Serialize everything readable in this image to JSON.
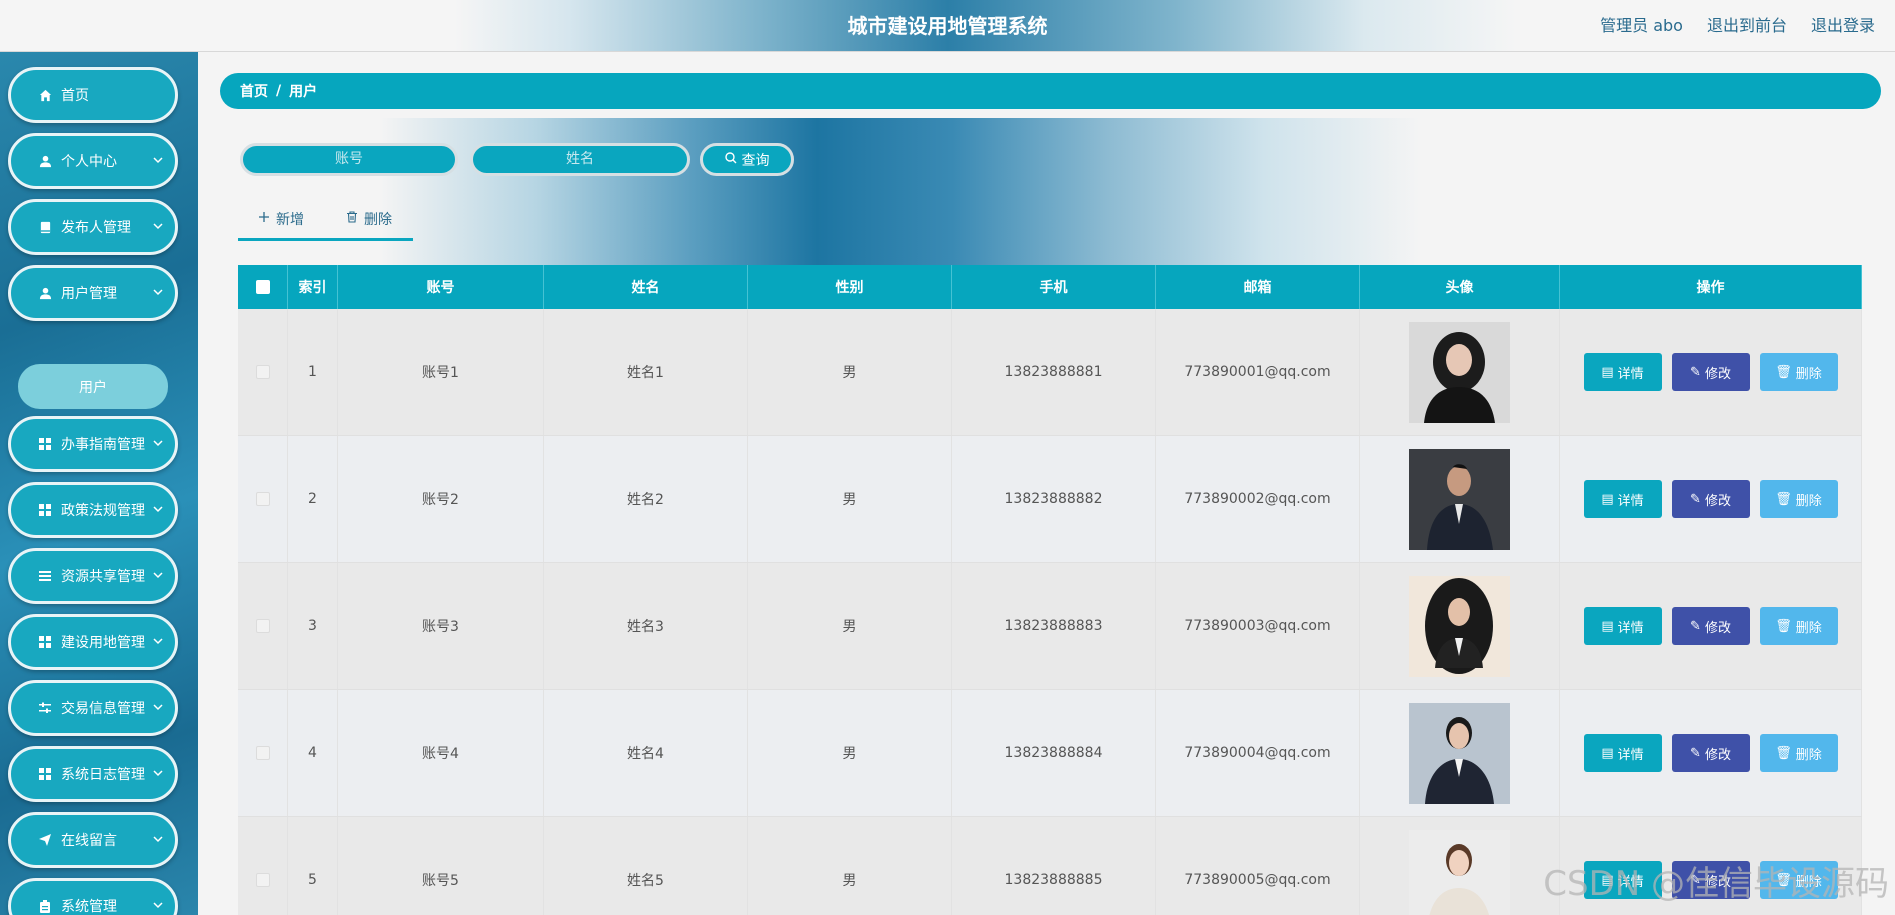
{
  "header": {
    "title": "城市建设用地管理系统",
    "admin_label": "管理员 abo",
    "front_link": "退出到前台",
    "logout_link": "退出登录"
  },
  "sidebar": {
    "items": [
      {
        "label": "首页",
        "icon": "home-icon"
      },
      {
        "label": "个人中心",
        "icon": "user-icon"
      },
      {
        "label": "发布人管理",
        "icon": "book-icon"
      },
      {
        "label": "用户管理",
        "icon": "user-icon"
      },
      {
        "label": "办事指南管理",
        "icon": "grid-icon"
      },
      {
        "label": "政策法规管理",
        "icon": "grid-icon"
      },
      {
        "label": "资源共享管理",
        "icon": "list-icon"
      },
      {
        "label": "建设用地管理",
        "icon": "grid-icon"
      },
      {
        "label": "交易信息管理",
        "icon": "sliders-icon"
      },
      {
        "label": "系统日志管理",
        "icon": "grid-icon"
      },
      {
        "label": "在线留言",
        "icon": "send-icon"
      },
      {
        "label": "系统管理",
        "icon": "clipboard-icon"
      }
    ],
    "subitem": "用户"
  },
  "breadcrumb": {
    "home": "首页",
    "sep": "/",
    "current": "用户"
  },
  "search": {
    "account_placeholder": "账号",
    "name_placeholder": "姓名",
    "button": "查询"
  },
  "actions": {
    "add": "新增",
    "delete": "删除"
  },
  "table": {
    "headers": [
      "索引",
      "账号",
      "姓名",
      "性别",
      "手机",
      "邮箱",
      "头像",
      "操作"
    ],
    "rows": [
      {
        "index": "1",
        "account": "账号1",
        "name": "姓名1",
        "gender": "男",
        "phone": "13823888881",
        "email": "773890001@qq.com"
      },
      {
        "index": "2",
        "account": "账号2",
        "name": "姓名2",
        "gender": "男",
        "phone": "13823888882",
        "email": "773890002@qq.com"
      },
      {
        "index": "3",
        "account": "账号3",
        "name": "姓名3",
        "gender": "男",
        "phone": "13823888883",
        "email": "773890003@qq.com"
      },
      {
        "index": "4",
        "account": "账号4",
        "name": "姓名4",
        "gender": "男",
        "phone": "13823888884",
        "email": "773890004@qq.com"
      },
      {
        "index": "5",
        "account": "账号5",
        "name": "姓名5",
        "gender": "男",
        "phone": "13823888885",
        "email": "773890005@qq.com"
      }
    ],
    "btn_detail": "详情",
    "btn_edit": "修改",
    "btn_delete": "删除"
  },
  "watermark": "CSDN @佳信毕设源码"
}
